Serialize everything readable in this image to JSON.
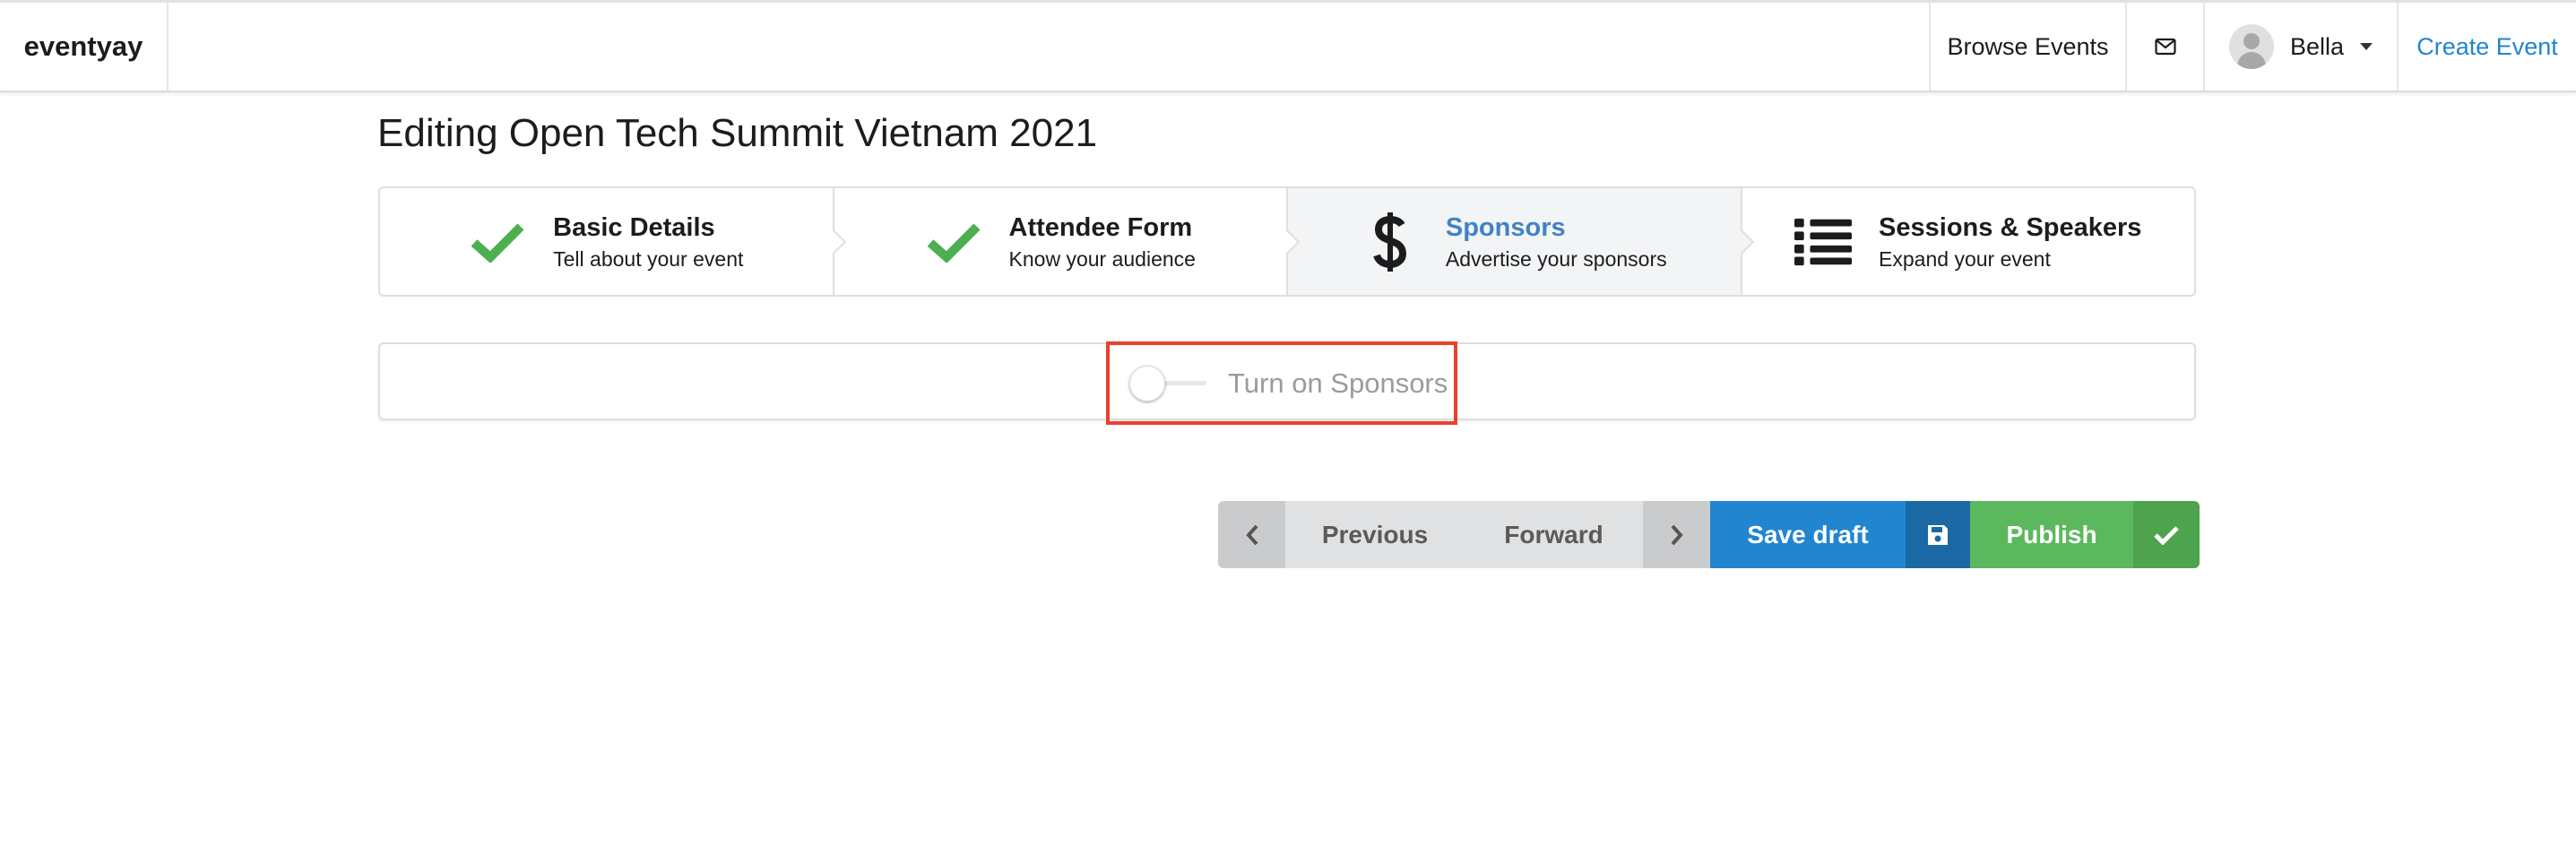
{
  "header": {
    "brand": "eventyay",
    "browse_events": "Browse Events",
    "mail_icon": "envelope-icon",
    "user_name": "Bella",
    "create_event": "Create Event"
  },
  "page": {
    "title": "Editing Open Tech Summit Vietnam 2021"
  },
  "steps": [
    {
      "title": "Basic Details",
      "description": "Tell about your event",
      "icon": "check-icon",
      "state": "completed"
    },
    {
      "title": "Attendee Form",
      "description": "Know your audience",
      "icon": "check-icon",
      "state": "completed"
    },
    {
      "title": "Sponsors",
      "description": "Advertise your sponsors",
      "icon": "dollar-icon",
      "state": "active"
    },
    {
      "title": "Sessions & Speakers",
      "description": "Expand your event",
      "icon": "list-icon",
      "state": "pending"
    }
  ],
  "sponsors_toggle": {
    "label": "Turn on Sponsors",
    "checked": false
  },
  "actions": {
    "previous": "Previous",
    "forward": "Forward",
    "save_draft": "Save draft",
    "publish": "Publish"
  },
  "colors": {
    "accent_blue": "#2185d0",
    "link_blue": "#4183c4",
    "success_green": "#5cb85c",
    "check_green": "#4caf50",
    "highlight_red": "#e8412c"
  }
}
